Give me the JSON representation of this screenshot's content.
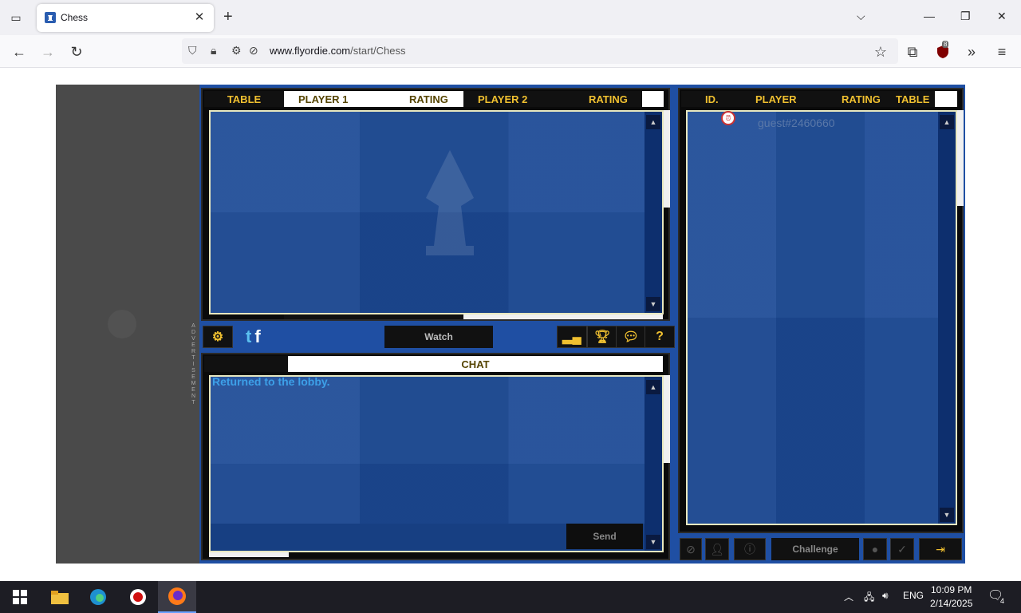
{
  "browser": {
    "tab_title": "Chess",
    "url_domain": "www.flyordie.com",
    "url_path": "/start/Chess",
    "extension_badge": "8"
  },
  "lobby": {
    "tables_headers": [
      "TABLE",
      "PLAYER 1",
      "RATING",
      "PLAYER 2",
      "RATING"
    ],
    "players_headers": [
      "ID.",
      "PLAYER",
      "RATING",
      "TABLE"
    ],
    "watch_label": "Watch",
    "chat_header": "CHAT",
    "chat_message": "Returned to the lobby.",
    "send_label": "Send",
    "challenge_label": "Challenge",
    "players": [
      {
        "name": "guest#2460660"
      }
    ],
    "advertisement_label": "ADVERTISEMENT"
  },
  "taskbar": {
    "language": "ENG",
    "time": "10:09 PM",
    "date": "2/14/2025",
    "notification_count": "4"
  },
  "colors": {
    "header_gold": "#f0c030",
    "board_blue": "#1c4a96",
    "chat_text": "#3da0e8"
  }
}
